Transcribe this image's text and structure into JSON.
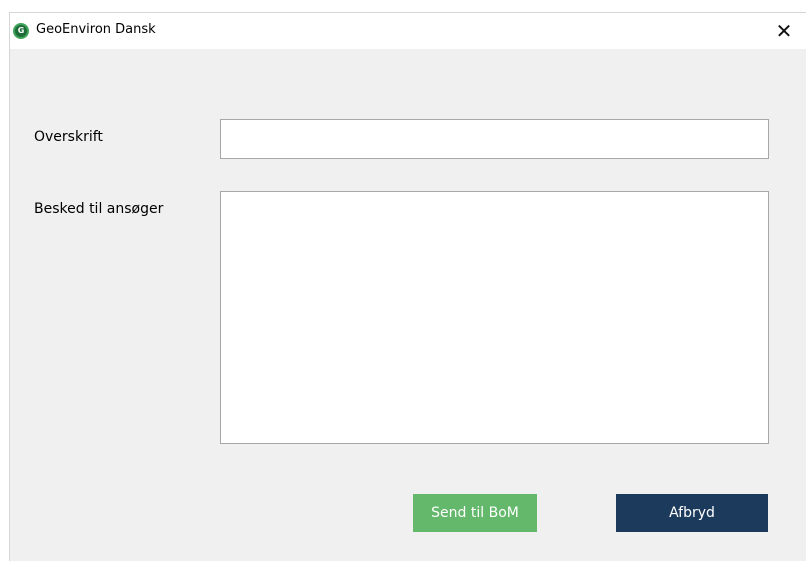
{
  "window": {
    "title": "GeoEnviron Dansk",
    "app_icon_glyph": "G",
    "app_icon_name": "geoenviron-logo-icon",
    "close_glyph": "✕",
    "close_icon_name": "close-icon"
  },
  "form": {
    "heading_label": "Overskrift",
    "heading_value": "",
    "message_label": "Besked til ansøger",
    "message_value": ""
  },
  "buttons": {
    "send_label": "Send til BoM",
    "cancel_label": "Afbryd"
  },
  "colors": {
    "send_button": "#63b86b",
    "cancel_button": "#1c3a5c",
    "background": "#f0f0f0",
    "icon": "#1e6b3a"
  }
}
